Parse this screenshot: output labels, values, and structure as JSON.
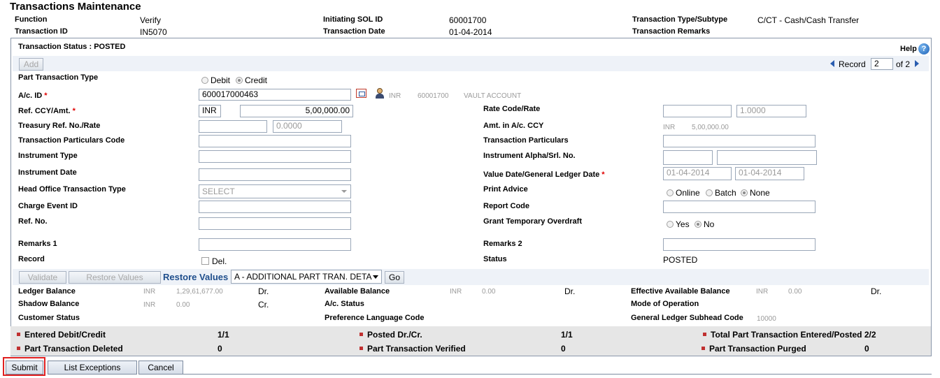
{
  "page_title": "Transactions Maintenance",
  "header": {
    "function_label": "Function",
    "function_value": "Verify",
    "sol_label": "Initiating SOL ID",
    "sol_value": "60001700",
    "type_label": "Transaction Type/Subtype",
    "type_value": "C/CT - Cash/Cash Transfer",
    "tran_id_label": "Transaction ID",
    "tran_id_value": "IN5070",
    "tran_date_label": "Transaction Date",
    "tran_date_value": "01-04-2014",
    "remarks_label": "Transaction Remarks"
  },
  "panel": {
    "status_text": "Transaction Status : POSTED",
    "help_label": "Help",
    "add_label": "Add",
    "record_label": "Record",
    "record_value": "2",
    "record_of": "of 2"
  },
  "form": {
    "part_tran_type_label": "Part Transaction Type",
    "debit_label": "Debit",
    "credit_label": "Credit",
    "ac_id_label": "A/c. ID",
    "ac_id_value": "600017000463",
    "ac_ccy": "INR",
    "ac_sol": "60001700",
    "ac_name": "VAULT ACCOUNT",
    "ref_ccy_label": "Ref. CCY/Amt.",
    "ref_ccy_value": "INR",
    "ref_amt_value": "5,00,000.00",
    "rate_code_label": "Rate Code/Rate",
    "rate_value": "1.0000",
    "treasury_label": "Treasury Ref. No./Rate",
    "treasury_rate_value": "0.0000",
    "amt_ac_ccy_label": "Amt. in A/c. CCY",
    "amt_ac_ccy_cur": "INR",
    "amt_ac_ccy_value": "5,00,000.00",
    "tran_part_code_label": "Transaction Particulars Code",
    "tran_part_label": "Transaction Particulars",
    "instr_type_label": "Instrument Type",
    "instr_alpha_label": "Instrument Alpha/Srl. No.",
    "instr_date_label": "Instrument Date",
    "value_date_label": "Value Date/General Ledger Date",
    "value_date_value": "01-04-2014",
    "gl_date_value": "01-04-2014",
    "ho_tran_label": "Head Office Transaction Type",
    "ho_tran_value": "SELECT",
    "print_advice_label": "Print Advice",
    "online_label": "Online",
    "batch_label": "Batch",
    "none_label": "None",
    "charge_label": "Charge Event ID",
    "report_code_label": "Report Code",
    "ref_no_label": "Ref. No.",
    "grant_od_label": "Grant Temporary Overdraft",
    "yes_label": "Yes",
    "no_label": "No",
    "remarks1_label": "Remarks 1",
    "remarks2_label": "Remarks 2",
    "record_label": "Record",
    "del_label": "Del.",
    "status_label": "Status",
    "status_value": "POSTED"
  },
  "actions": {
    "validate_label": "Validate",
    "restore_btn_label": "Restore Values",
    "restore_link_label": "Restore Values",
    "select_value": "A - ADDITIONAL PART TRAN. DETA",
    "go_label": "Go"
  },
  "balances": {
    "ledger_label": "Ledger Balance",
    "ledger_cur": "INR",
    "ledger_value": "1,29,61,677.00",
    "ledger_dc": "Dr.",
    "avail_label": "Available Balance",
    "avail_cur": "INR",
    "avail_value": "0.00",
    "avail_dc": "Dr.",
    "eff_label": "Effective Available Balance",
    "eff_cur": "INR",
    "eff_value": "0.00",
    "eff_dc": "Dr.",
    "shadow_label": "Shadow Balance",
    "shadow_cur": "INR",
    "shadow_value": "0.00",
    "shadow_dc": "Cr.",
    "ac_status_label": "A/c. Status",
    "mode_label": "Mode of Operation",
    "cust_status_label": "Customer Status",
    "pref_lang_label": "Preference Language Code",
    "gl_subhead_label": "General Ledger Subhead Code",
    "gl_subhead_value": "10000"
  },
  "summary": {
    "entered_label": "Entered Debit/Credit",
    "entered_value": "1/1",
    "posted_label": "Posted Dr./Cr.",
    "posted_value": "1/1",
    "total_label": "Total Part Transaction Entered/Posted",
    "total_value": "2/2",
    "deleted_label": "Part Transaction Deleted",
    "deleted_value": "0",
    "verified_label": "Part Transaction Verified",
    "verified_value": "0",
    "purged_label": "Part Transaction Purged",
    "purged_value": "0"
  },
  "footer": {
    "submit_label": "Submit",
    "list_exceptions_label": "List Exceptions",
    "cancel_label": "Cancel"
  },
  "colors": {
    "highlight_red": "#e02020",
    "link_blue": "#1f4e8c",
    "panel_bg": "#eef2f8"
  },
  "icons": [
    "calendar-icon",
    "customer-icon",
    "help-icon",
    "prev-record-icon",
    "next-record-icon",
    "dropdown-arrow-icon"
  ]
}
